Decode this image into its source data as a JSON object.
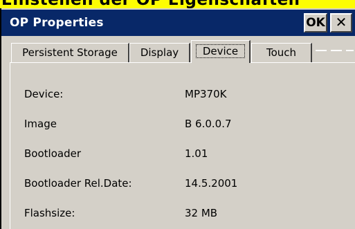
{
  "header_strip": {
    "text": "Einstellen der OP Eigenschaften"
  },
  "window": {
    "title": "OP Properties",
    "ok_label": "OK",
    "close_label": "✕"
  },
  "tabs": [
    {
      "label": "Persistent Storage",
      "active": false
    },
    {
      "label": "Display",
      "active": false
    },
    {
      "label": "Device",
      "active": true
    },
    {
      "label": "Touch",
      "active": false
    }
  ],
  "device_info": [
    {
      "label": "Device:",
      "value": "MP370K"
    },
    {
      "label": "Image",
      "value": "B 6.0.0.7"
    },
    {
      "label": "Bootloader",
      "value": "1.01"
    },
    {
      "label": "Bootloader Rel.Date:",
      "value": "14.5.2001"
    },
    {
      "label": "Flashsize:",
      "value": "32 MB"
    }
  ],
  "colors": {
    "titlebar": "#082868",
    "face": "#d4d0c8",
    "highlight_strip": "#fdfd02"
  }
}
